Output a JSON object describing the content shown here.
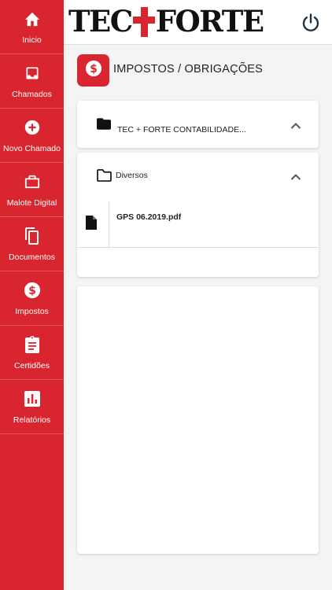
{
  "app": {
    "logo_left": "TEC",
    "logo_right": "FORTE",
    "brand_color": "#d9252f"
  },
  "sidebar": {
    "items": [
      {
        "label": "Inicio",
        "icon": "home-icon"
      },
      {
        "label": "Chamados",
        "icon": "inbox-icon"
      },
      {
        "label": "Novo Chamado",
        "icon": "add-circle-icon"
      },
      {
        "label": "Malote Digital",
        "icon": "briefcase-icon"
      },
      {
        "label": "Documentos",
        "icon": "copy-documents-icon"
      },
      {
        "label": "Impostos",
        "icon": "dollar-circle-icon"
      },
      {
        "label": "Certidões",
        "icon": "clipboard-icon"
      },
      {
        "label": "Relatórios",
        "icon": "bar-chart-icon"
      }
    ]
  },
  "header": {
    "power_icon": "power-icon"
  },
  "page": {
    "title": "IMPOSTOS / OBRIGAÇÕES",
    "title_icon": "dollar-circle-icon"
  },
  "folders": [
    {
      "name": "TEC + FORTE CONTABILIDADE...",
      "icon": "folder-filled-icon",
      "expanded": true
    },
    {
      "name": "Diversos",
      "icon": "folder-outline-icon",
      "expanded": true,
      "files": [
        {
          "name": "GPS 06.2019.pdf",
          "icon": "file-icon"
        }
      ]
    }
  ]
}
